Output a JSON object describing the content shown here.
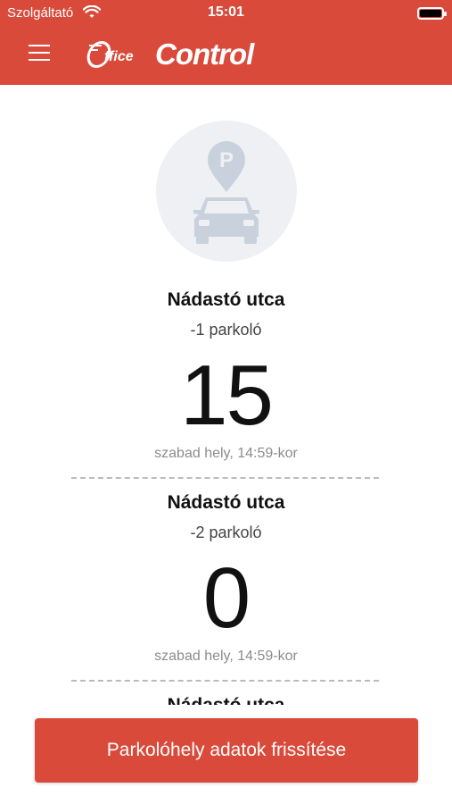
{
  "status_bar": {
    "carrier": "Szolgáltató",
    "time": "15:01"
  },
  "header": {
    "logo_office": "ffice",
    "logo_control": "Control",
    "brand_color": "#d94a3b"
  },
  "entries": [
    {
      "name": "Nádastó utca",
      "level": "-1 parkoló",
      "free_count": "15",
      "updated": "szabad hely, 14:59-kor"
    },
    {
      "name": "Nádastó utca",
      "level": "-2 parkoló",
      "free_count": "0",
      "updated": "szabad hely, 14:59-kor"
    },
    {
      "name": "Nádastó utca"
    }
  ],
  "refresh_button": {
    "label": "Parkolóhely adatok frissítése"
  },
  "icons": {
    "menu": "hamburger-menu-icon",
    "parking": "parking-car-icon",
    "wifi": "wifi-icon",
    "battery": "battery-icon"
  }
}
